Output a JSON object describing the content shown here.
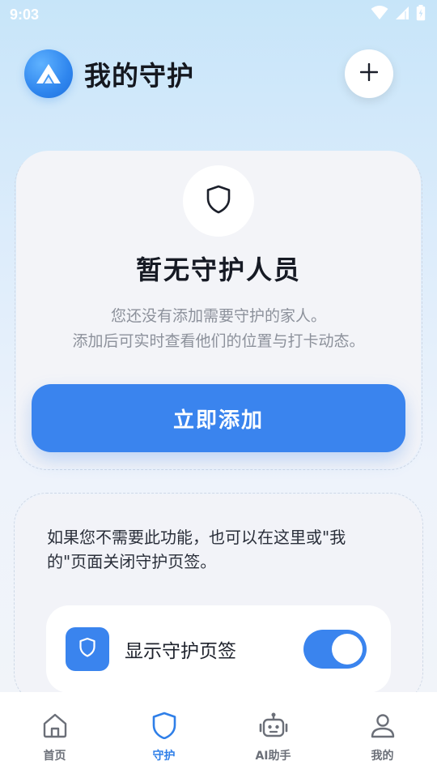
{
  "status_bar": {
    "time": "9:03",
    "icons": [
      "wifi-icon",
      "signal-icon",
      "battery-icon"
    ]
  },
  "header": {
    "title": "我的守护",
    "logo_icon": "app-logo-icon",
    "add_icon": "plus-icon"
  },
  "empty_state": {
    "icon": "shield-icon",
    "title": "暂无守护人员",
    "desc_line1": "您还没有添加需要守护的家人。",
    "desc_line2": "添加后可实时查看他们的位置与打卡动态。",
    "button_label": "立即添加"
  },
  "settings_card": {
    "hint_line1": "如果您不需要此功能，也可以在这里或\"我",
    "hint_line2": "的\"页面关闭守护页签。",
    "toggle_label": "显示守护页签",
    "toggle_on": true
  },
  "bottom_nav": {
    "items": [
      {
        "label": "首页",
        "icon": "home-icon",
        "active": false
      },
      {
        "label": "守护",
        "icon": "shield-icon",
        "active": true
      },
      {
        "label": "AI助手",
        "icon": "robot-icon",
        "active": false
      },
      {
        "label": "我的",
        "icon": "person-icon",
        "active": false
      }
    ]
  },
  "colors": {
    "accent": "#3a84ee",
    "text_dark": "#161a24",
    "text_muted": "#8c919b",
    "nav_inactive": "#6b6f78"
  }
}
